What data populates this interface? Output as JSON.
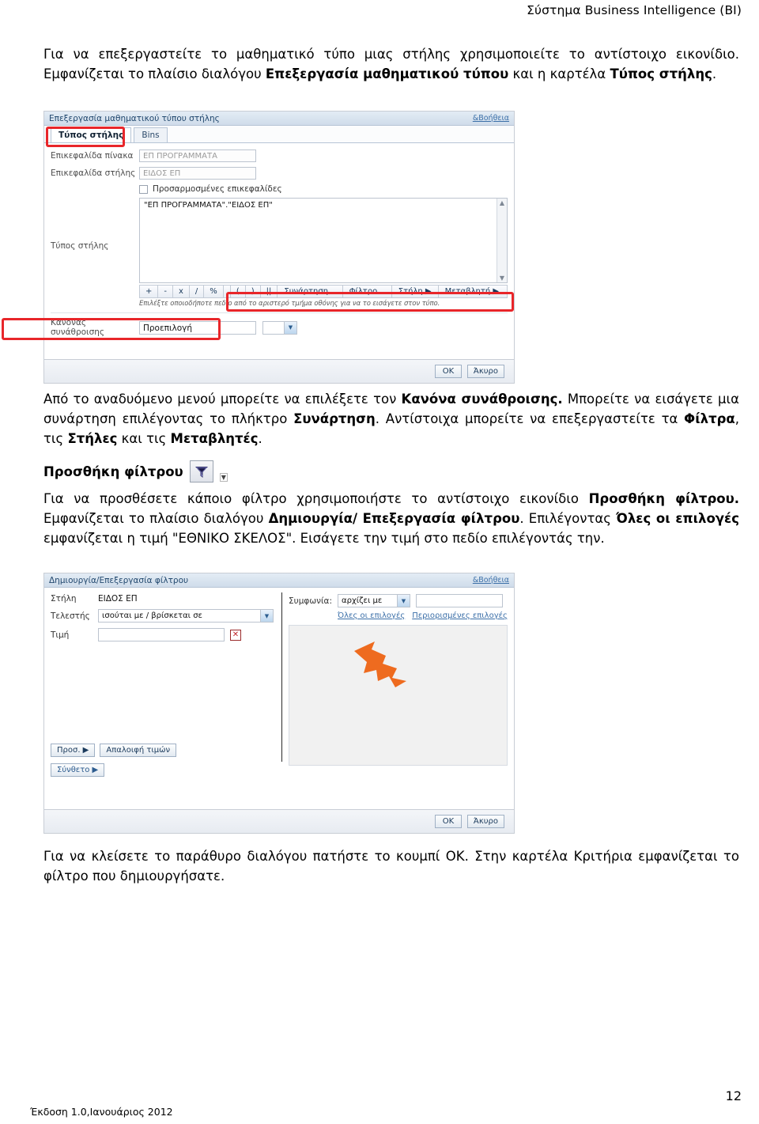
{
  "page": {
    "header_title": "Σύστημα Business Intelligence (BI)",
    "footer_version": "Έκδοση 1.0,Ιανουάριος 2012",
    "page_number": "12"
  },
  "paragraphs": {
    "p1_part1": "Για να επεξεργαστείτε το μαθηματικό τύπο μιας στήλης χρησιμοποιείτε το αντίστοιχο εικονίδιο. Εμφανίζεται το πλαίσιο διαλόγου ",
    "p1_bold1": "Επεξεργασία μαθηματικού τύπου",
    "p1_part2": " και η καρτέλα ",
    "p1_bold2": "Τύπος στήλης",
    "p1_part3": ".",
    "p2_part1": "Από το αναδυόμενο μενού μπορείτε να επιλέξετε τον ",
    "p2_bold1": "Κανόνα συνάθροισης.",
    "p2_part2": " Μπορείτε να εισάγετε μια συνάρτηση επιλέγοντας το πλήκτρο ",
    "p2_bold2": "Συνάρτηση",
    "p2_part3": ". Αντίστοιχα μπορείτε να επεξεργαστείτε τα ",
    "p2_bold3": "Φίλτρα",
    "p2_part4": ", τις ",
    "p2_bold4": "Στήλες",
    "p2_part5": " και τις ",
    "p2_bold5": "Μεταβλητές",
    "p2_part6": ".",
    "subhead_label": "Προσθήκη φίλτρου",
    "p3_part1": "Για να προσθέσετε κάποιο φίλτρο χρησιμοποιήστε το αντίστοιχο εικονίδιο ",
    "p3_bold1": "Προσθήκη φίλτρου.",
    "p3_part2": " Εμφανίζεται το πλαίσιο διαλόγου ",
    "p3_bold2": "Δημιουργία/ Επεξεργασία φίλτρου",
    "p3_part3": ". Επιλέγοντας ",
    "p3_bold3": "Όλες οι επιλογές",
    "p3_part4": " εμφανίζεται η τιμή \"ΕΘΝΙΚΟ ΣΚΕΛΟΣ\". Εισάγετε την τιμή στο πεδίο επιλέγοντάς την.",
    "p4_text": "Για να κλείσετε το παράθυρο διαλόγου πατήστε το κουμπί ΟΚ. Στην καρτέλα Κριτήρια εμφανίζεται το φίλτρο που δημιουργήσατε."
  },
  "dialog_formula": {
    "title": "Επεξεργασία μαθηματικού τύπου στήλης",
    "help_link": "&Βοήθεια",
    "tabs": [
      {
        "label": "Τύπος στήλης",
        "active": true
      },
      {
        "label": "Bins",
        "active": false
      }
    ],
    "fields": {
      "table_heading_label": "Επικεφαλίδα πίνακα",
      "table_heading_value": "ΕΠ ΠΡΟΓΡΑΜΜΑΤΑ",
      "column_heading_label": "Επικεφαλίδα στήλης",
      "column_heading_value": "ΕΙΔΟΣ ΕΠ",
      "custom_headings_label": "Προσαρμοσμένες επικεφαλίδες",
      "formula_label": "Τύπος στήλης",
      "formula_value": "\"ΕΠ ΠΡΟΓΡΑΜΜΑΤΑ\".\"ΕΙΔΟΣ ΕΠ\"",
      "aggregation_label": "Κανόνας συνάθροισης",
      "aggregation_value": "Προεπιλογή"
    },
    "operator_buttons": [
      "+",
      "-",
      "x",
      "/",
      "%"
    ],
    "insert_buttons": [
      "(",
      ")",
      "||",
      "Συνάρτηση...",
      "Φίλτρο...",
      "Στήλη ▶",
      "Μεταβλητή ▶"
    ],
    "hint": "Επιλέξτε οποιοδήποτε πεδίο από το αριστερό τμήμα οθόνης για να το εισάγετε στον τύπο.",
    "ok_label": "OK",
    "cancel_label": "Άκυρο"
  },
  "dialog_filter": {
    "title": "Δημιουργία/Επεξεργασία φίλτρου",
    "help_link": "&Βοήθεια",
    "column_label": "Στήλη",
    "column_value": "ΕΙΔΟΣ ΕΠ",
    "operator_label": "Τελεστής",
    "operator_value": "ισούται με / βρίσκεται σε",
    "value_label": "Τιμή",
    "value_value": "",
    "clear_value_icon": "✕",
    "match_label": "Συμφωνία:",
    "match_value": "αρχίζει με",
    "match_text_value": "",
    "all_choices_link": "Όλες οι επιλογές",
    "limited_choices_link": "Περιορισμένες επιλογές",
    "add_button": "Προσ. ▶",
    "clear_values_button": "Απαλοιφή τιμών",
    "advanced_button": "Σύνθετο ▶",
    "ok_label": "OK",
    "cancel_label": "Άκυρο"
  },
  "icons": {
    "filter_funnel": "filter-funnel-icon",
    "orange_arrow": "orange-arrow-cursor"
  },
  "colors": {
    "annotation_red": "#e8262a",
    "dialog_title_blue": "#22486e",
    "link_blue": "#3b6fa8",
    "arrow_orange": "#ee6b1f"
  }
}
